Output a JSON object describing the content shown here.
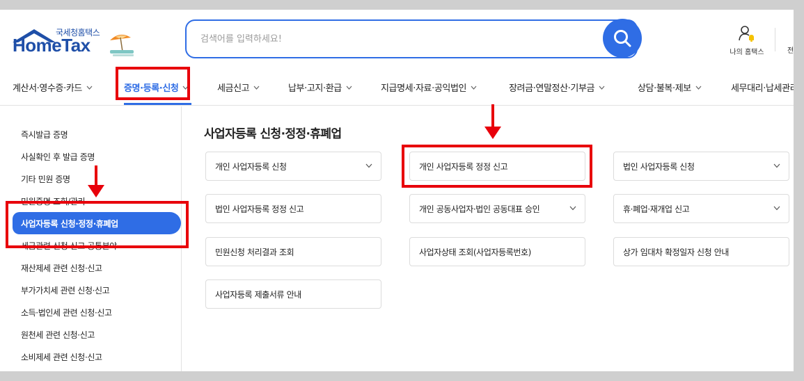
{
  "header": {
    "logo_sub": "국세청홈택스",
    "logo_main": "HomeTax",
    "search_placeholder": "검색어를 입력하세요!",
    "my_hometax": "나의 홈택스",
    "all_menu": "전체메"
  },
  "gnb": [
    {
      "label": "계산서·영수증·카드"
    },
    {
      "label": "증명·등록·신청"
    },
    {
      "label": "세금신고"
    },
    {
      "label": "납부·고지·환급"
    },
    {
      "label": "지급명세·자료·공익법인"
    },
    {
      "label": "장려금·연말정산·기부금"
    },
    {
      "label": "상담·불복·제보"
    },
    {
      "label": "세무대리·납세관리"
    }
  ],
  "sidebar": [
    {
      "label": "즉시발급 증명"
    },
    {
      "label": "사실확인 후 발급 증명"
    },
    {
      "label": "기타 민원 증명"
    },
    {
      "label": "민원증명 조회/관리"
    },
    {
      "label": "사업자등록 신청·정정·휴폐업"
    },
    {
      "label": "세금관련 신청·신고 공통분야"
    },
    {
      "label": "재산제세 관련 신청·신고"
    },
    {
      "label": "부가가치세 관련 신청·신고"
    },
    {
      "label": "소득·법인세 관련 신청·신고"
    },
    {
      "label": "원천세 관련 신청·신고"
    },
    {
      "label": "소비제세 관련 신청·신고"
    }
  ],
  "content": {
    "title": "사업자등록 신청·정정·휴폐업",
    "cards": [
      {
        "label": "개인 사업자등록 신청"
      },
      {
        "label": "개인 사업자등록 정정 신고"
      },
      {
        "label": "법인 사업자등록 신청"
      },
      {
        "label": "법인 사업자등록 정정 신고"
      },
      {
        "label": "개인 공동사업자·법인 공동대표 승인"
      },
      {
        "label": "휴·폐업·재개업 신고"
      },
      {
        "label": "민원신청 처리결과 조회"
      },
      {
        "label": "사업자상태 조회(사업자등록번호)"
      },
      {
        "label": "상가 임대차 확정일자 신청 안내"
      },
      {
        "label": "사업자등록 제출서류 안내"
      }
    ]
  },
  "colors": {
    "accent": "#2f6de5",
    "logo": "#1f4fa8",
    "annotation": "#e8000b",
    "background": "#cfcfcf"
  },
  "icons": [
    "search-icon",
    "user-bell-icon",
    "menu-icon",
    "chevron-down-icon",
    "house-logo-icon",
    "red-arrow-down-icon"
  ]
}
